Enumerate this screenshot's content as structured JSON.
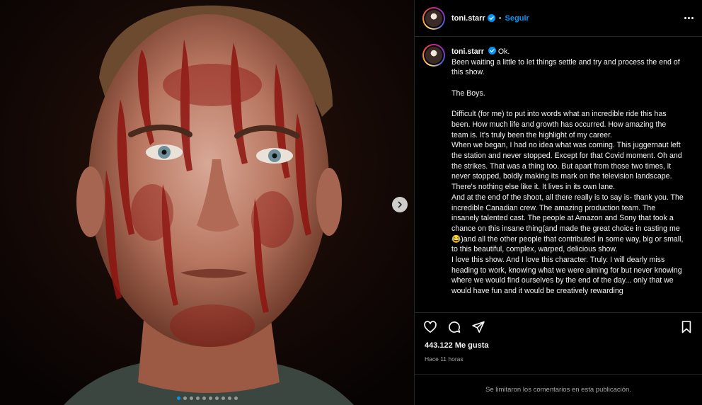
{
  "post": {
    "username": "toni.starr",
    "follow_label": "Seguir",
    "bullet": "•",
    "caption_head": "Ok.",
    "caption_paragraphs": [
      "Been waiting a little to let things settle and try and process the end of this show.",
      "",
      "The Boys.",
      "",
      "Difficult (for me) to put into words what an incredible ride this has been. How much life and growth has occurred. How amazing the team is. It's truly been the highlight of my career.\nWhen we began, I had no idea what was coming. This juggernaut left the station and never stopped. Except for that Covid moment. Oh and the strikes. That was a thing too. But apart from those two times, it never stopped, boldly making its mark on the television landscape. There's nothing else like it. It lives in its own lane.\nAnd at the end of the shoot, all there really is to say is- thank you. The incredible Canadian crew. The amazing production team. The insanely talented cast. The people at Amazon and Sony that took a chance on this insane thing(and made the great choice in casting me😂)and all the other people that contributed in some way, big or small, to this beautiful, complex, warped, delicious show.\nI love this show. And I love this character. Truly. I will dearly miss heading to work, knowing what we were aiming for but never knowing where we would find ourselves by the end of the day... only that we would have fun and it would be creatively rewarding"
    ],
    "likes": "443.122 Me gusta",
    "time_ago": "Hace 11 horas",
    "comments_disabled": "Se limitaron los comentarios en esta publicación.",
    "carousel": {
      "total": 10,
      "active_index": 0
    }
  },
  "colors": {
    "accent_blue": "#0095f6",
    "background": "#000000",
    "secondary_text": "#a8a8a8",
    "border": "#262626"
  },
  "icons": {
    "like": "heart-icon",
    "comment": "comment-bubble-icon",
    "share": "paper-plane-icon",
    "save": "bookmark-icon",
    "more": "more-options-icon",
    "next": "chevron-right-icon",
    "verified": "verified-badge-icon"
  }
}
